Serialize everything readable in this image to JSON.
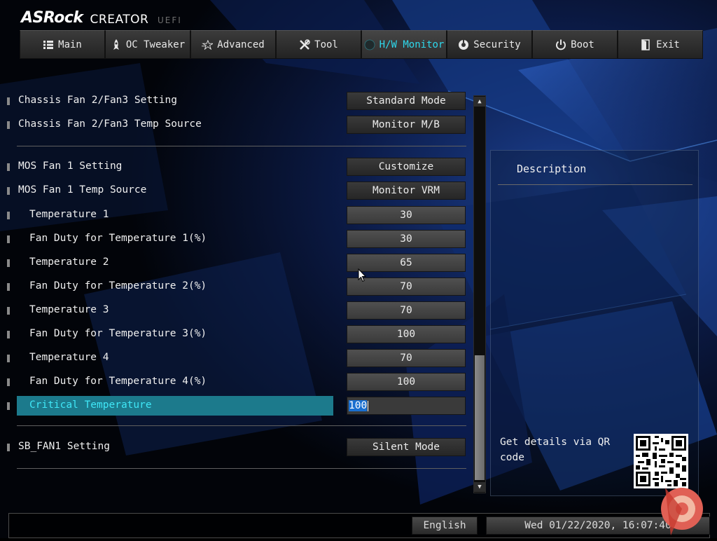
{
  "header": {
    "brand": "ASRock",
    "product": "CREATOR",
    "subtitle": "UEFI"
  },
  "tabs": [
    {
      "label": "Main",
      "icon": "list-icon",
      "active": false
    },
    {
      "label": "OC Tweaker",
      "icon": "rocket-icon",
      "active": false
    },
    {
      "label": "Advanced",
      "icon": "star-icon",
      "active": false
    },
    {
      "label": "Tool",
      "icon": "tools-icon",
      "active": false
    },
    {
      "label": "H/W Monitor",
      "icon": "monitor-icon",
      "active": true
    },
    {
      "label": "Security",
      "icon": "shield-icon",
      "active": false
    },
    {
      "label": "Boot",
      "icon": "power-icon",
      "active": false
    },
    {
      "label": "Exit",
      "icon": "exit-icon",
      "active": false
    }
  ],
  "settings": [
    {
      "label": "Chassis Fan 2/Fan3 Setting",
      "value": "Standard Mode"
    },
    {
      "label": "Chassis Fan 2/Fan3 Temp Source",
      "value": "Monitor M/B"
    },
    {
      "label": "MOS Fan 1 Setting",
      "value": "Customize"
    },
    {
      "label": "MOS Fan 1 Temp Source",
      "value": "Monitor VRM"
    },
    {
      "label": "Temperature 1",
      "value": "30"
    },
    {
      "label": "Fan Duty for Temperature 1(%)",
      "value": "30"
    },
    {
      "label": "Temperature 2",
      "value": "65"
    },
    {
      "label": "Fan Duty for Temperature 2(%)",
      "value": "70"
    },
    {
      "label": "Temperature 3",
      "value": "70"
    },
    {
      "label": "Fan Duty for Temperature 3(%)",
      "value": "100"
    },
    {
      "label": "Temperature 4",
      "value": "70"
    },
    {
      "label": "Fan Duty for Temperature 4(%)",
      "value": "100"
    },
    {
      "label": "Critical Temperature",
      "value": "100"
    },
    {
      "label": "SB_FAN1 Setting",
      "value": "Silent Mode"
    }
  ],
  "description": {
    "title": "Description",
    "qr_text": "Get details via QR code"
  },
  "status": {
    "language": "English",
    "datetime": "Wed 01/22/2020, 16:07:40"
  },
  "colors": {
    "accent": "#2ed8ec",
    "selection": "#1c7a8c"
  }
}
